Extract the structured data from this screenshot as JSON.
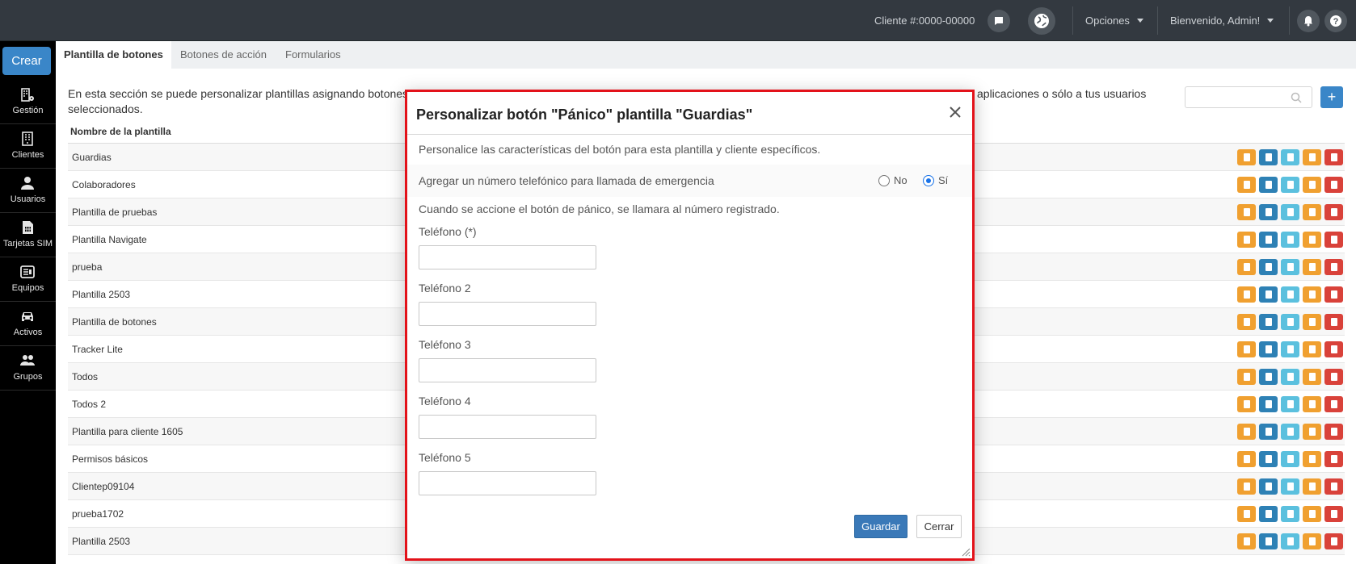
{
  "topbar": {
    "client_id": "Cliente #:0000-00000",
    "options_label": "Opciones",
    "welcome_label": "Bienvenido, Admin!"
  },
  "sidebar": {
    "create_label": "Crear",
    "items": [
      {
        "label": "Gestión",
        "icon": "building-gear-icon"
      },
      {
        "label": "Clientes",
        "icon": "building-icon"
      },
      {
        "label": "Usuarios",
        "icon": "user-icon"
      },
      {
        "label": "Tarjetas SIM",
        "icon": "sim-card-icon"
      },
      {
        "label": "Equipos",
        "icon": "device-icon"
      },
      {
        "label": "Activos",
        "icon": "car-icon"
      },
      {
        "label": "Grupos",
        "icon": "group-icon"
      }
    ]
  },
  "tabs": [
    {
      "label": "Plantilla de botones",
      "active": true
    },
    {
      "label": "Botones de acción",
      "active": false
    },
    {
      "label": "Formularios",
      "active": false
    }
  ],
  "main": {
    "description_left": "En esta sección se puede personalizar plantillas asignando botones",
    "description_left_line2": "seleccionados.",
    "description_right": "aplicaciones o sólo a tus usuarios",
    "search_placeholder": "",
    "add_label": "+",
    "table_header": "Nombre de la plantilla",
    "rows": [
      "Guardias",
      "Colaboradores",
      "Plantilla de pruebas",
      "Plantilla Navigate",
      "prueba",
      "Plantilla 2503",
      "Plantilla de botones",
      "Tracker Lite",
      "Todos",
      "Todos 2",
      "Plantilla para cliente 1605",
      "Permisos básicos",
      "Clientep09104",
      "prueba1702",
      "Plantilla 2503"
    ]
  },
  "modal": {
    "title": "Personalizar botón \"Pánico\" plantilla \"Guardias\"",
    "subtitle": "Personalice las características del botón para esta plantilla y cliente específicos.",
    "emergency_label": "Agregar un número telefónico para llamada de emergencia",
    "radio_no": "No",
    "radio_yes": "Sí",
    "selected": "Sí",
    "note": "Cuando se accione el botón de pánico, se llamara al número registrado.",
    "fields": [
      {
        "label": "Teléfono (*)",
        "value": ""
      },
      {
        "label": "Teléfono 2",
        "value": ""
      },
      {
        "label": "Teléfono 3",
        "value": ""
      },
      {
        "label": "Teléfono 4",
        "value": ""
      },
      {
        "label": "Teléfono 5",
        "value": ""
      }
    ],
    "save_label": "Guardar",
    "close_label": "Cerrar"
  },
  "colors": {
    "primary": "#3a86c8",
    "highlight_border": "#e3121a",
    "action_edit": "#f0a030",
    "action_doc": "#2e81b5",
    "action_device": "#5bc0de",
    "action_copy": "#f0a030",
    "action_delete": "#d9423a"
  }
}
